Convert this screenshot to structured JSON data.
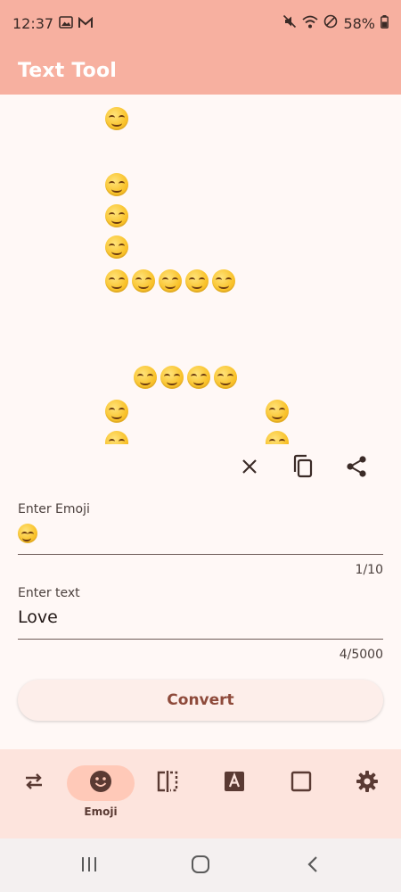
{
  "status_bar": {
    "time": "12:37",
    "battery": "58%"
  },
  "app_bar": {
    "title": "Text Tool"
  },
  "output": {
    "emoji": "😊",
    "text": "Love"
  },
  "actions": {
    "clear": "close-icon",
    "copy": "copy-icon",
    "share": "share-icon"
  },
  "emoji_field": {
    "label": "Enter Emoji",
    "value": "😊",
    "counter": "1/10"
  },
  "text_field": {
    "label": "Enter text",
    "value": "Love",
    "counter": "4/5000"
  },
  "convert_button": {
    "label": "Convert"
  },
  "bottom_nav": {
    "items": [
      {
        "icon": "swap-icon",
        "label": ""
      },
      {
        "icon": "emoji-icon",
        "label": "Emoji"
      },
      {
        "icon": "mirror-icon",
        "label": ""
      },
      {
        "icon": "font-icon",
        "label": ""
      },
      {
        "icon": "square-icon",
        "label": ""
      },
      {
        "icon": "gear-icon",
        "label": ""
      }
    ],
    "active_index": 1
  },
  "colors": {
    "header": "#f7b0a0",
    "accent": "#8e4a3b",
    "nav_background": "#fde4dd"
  }
}
